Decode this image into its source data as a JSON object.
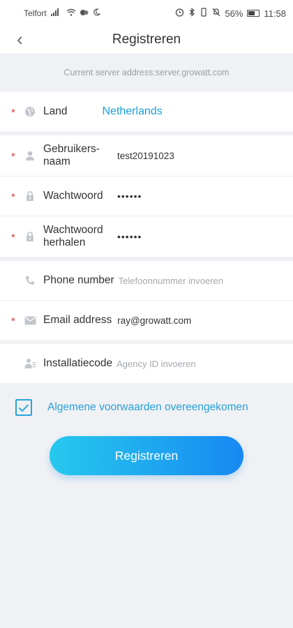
{
  "status_bar": {
    "carrier": "Telfort",
    "battery": "56%",
    "battery_level": 0.56,
    "time": "11:58"
  },
  "header": {
    "title": "Registreren",
    "back_glyph": "‹"
  },
  "server": {
    "text": "Current server address:server.growatt.com"
  },
  "form": {
    "land": {
      "label": "Land",
      "value": "Netherlands"
    },
    "username": {
      "label_line1": "Gebruikers-",
      "label_line2": "naam",
      "value": "test20191023"
    },
    "password": {
      "label": "Wachtwoord",
      "value": "••••••"
    },
    "password_repeat": {
      "label_line1": "Wachtwoord",
      "label_line2": "herhalen",
      "value": "••••••"
    },
    "phone": {
      "label": "Phone number",
      "placeholder": "Telefoonnummer invoeren"
    },
    "email": {
      "label": "Email address",
      "value": "ray@growatt.com"
    },
    "install_code": {
      "label": "Installatiecode",
      "placeholder": "Agency ID invoeren"
    },
    "required_mark": "*"
  },
  "terms": {
    "checked": true,
    "label": "Algemene voorwaarden overeengekomen"
  },
  "submit": {
    "label": "Registreren"
  },
  "colors": {
    "accent": "#1aa0d9",
    "required": "#d93a3a",
    "button_start": "#27c9ee",
    "button_end": "#1688f2"
  }
}
